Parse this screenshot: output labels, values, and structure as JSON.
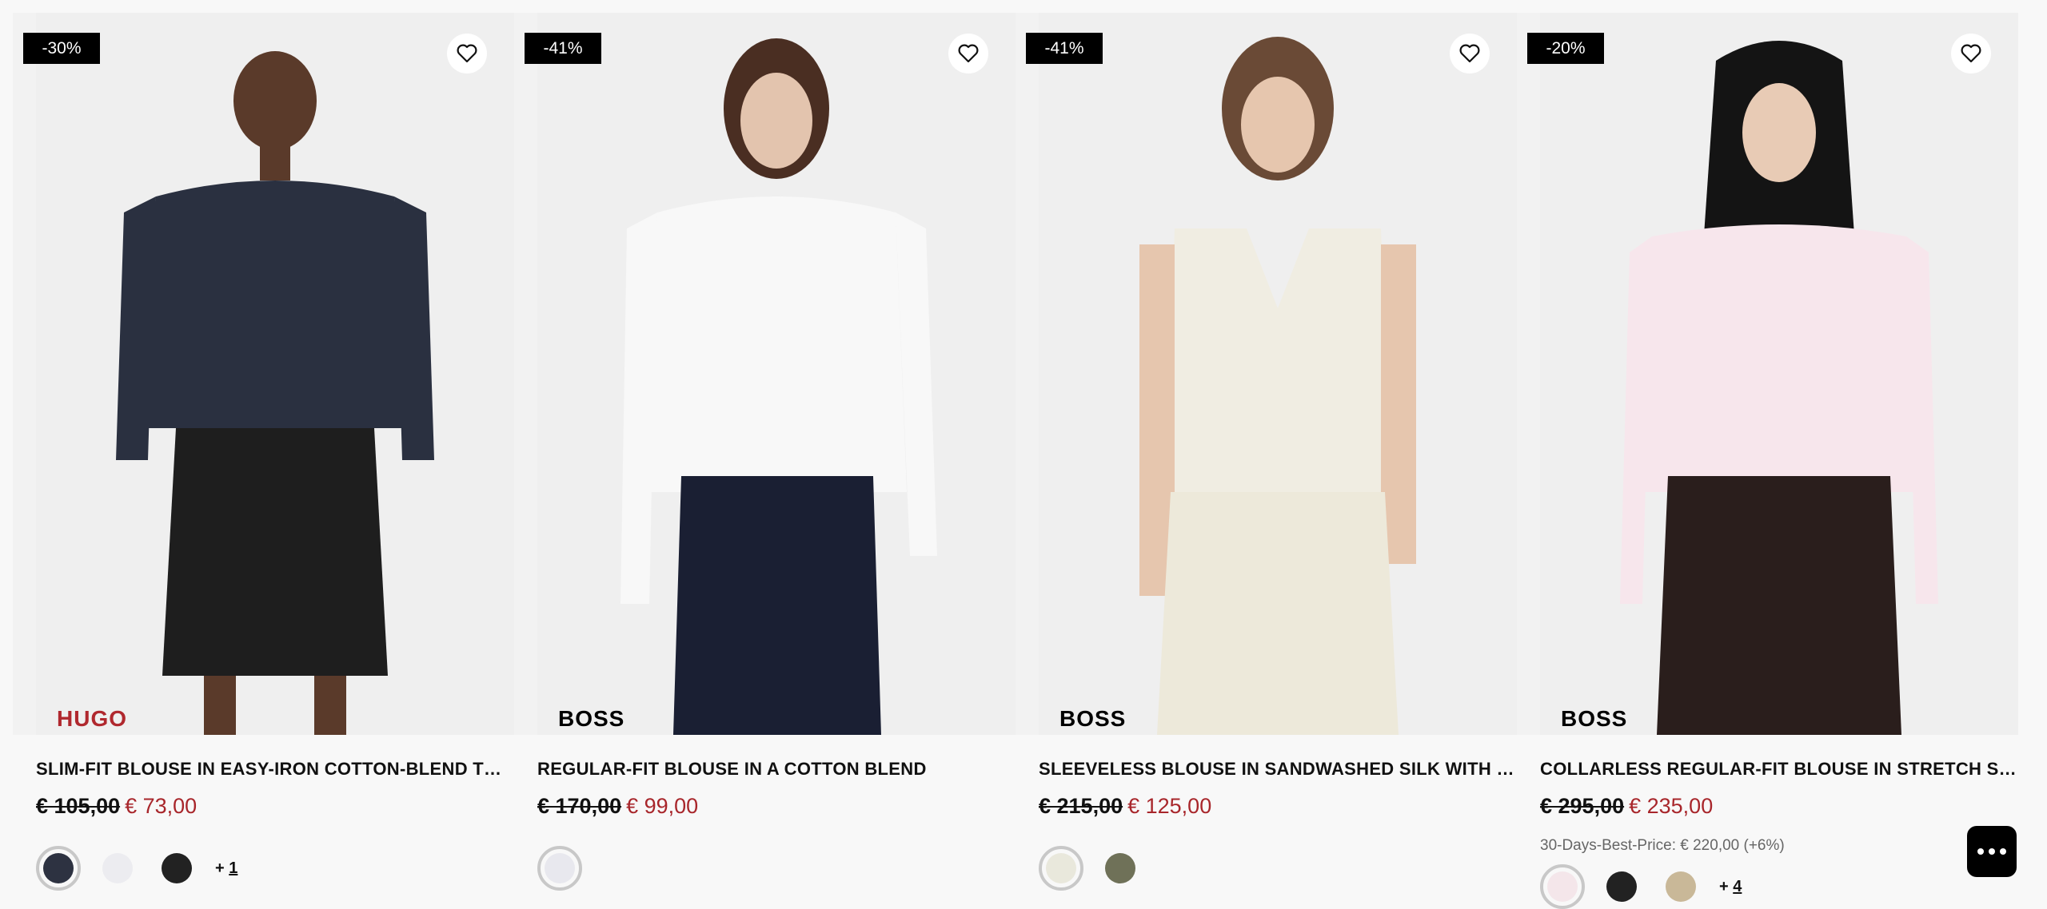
{
  "products": [
    {
      "discount": "-30%",
      "brand": "HUGO",
      "title": "SLIM-FIT BLOUSE IN EASY-IRON COTTON-BLEND TWILL",
      "old_price": "€ 105,00",
      "new_price": "€ 73,00",
      "best_price": "",
      "swatches": [
        "#2d3241",
        "#ececf0",
        "#222222"
      ],
      "more_label": "+ ",
      "more_count": "1",
      "colors": {
        "top": "#2a3040",
        "bottom": "#1e1e1e"
      }
    },
    {
      "discount": "-41%",
      "brand": "BOSS",
      "title": "REGULAR-FIT BLOUSE IN A COTTON BLEND",
      "old_price": "€ 170,00",
      "new_price": "€ 99,00",
      "best_price": "",
      "swatches": [
        "#e8e8ee"
      ],
      "more_label": "",
      "more_count": "",
      "colors": {
        "top": "#f6f6f6",
        "bottom": "#1a1f33"
      }
    },
    {
      "discount": "-41%",
      "brand": "BOSS",
      "title": "SLEEVELESS BLOUSE IN SANDWASHED SILK WITH V NECK",
      "old_price": "€ 215,00",
      "new_price": "€ 125,00",
      "best_price": "",
      "swatches": [
        "#e9e8dc",
        "#6f7158"
      ],
      "more_label": "",
      "more_count": "",
      "colors": {
        "top": "#f0ede2",
        "bottom": "#ede9da"
      }
    },
    {
      "discount": "-20%",
      "brand": "BOSS",
      "title": "COLLARLESS REGULAR-FIT BLOUSE IN STRETCH SILK",
      "old_price": "€ 295,00",
      "new_price": "€ 235,00",
      "best_price": "30-Days-Best-Price: € 220,00 (+6%)",
      "swatches": [
        "#f4e6ea",
        "#222222",
        "#c9b898"
      ],
      "more_label": "+ ",
      "more_count": "4",
      "colors": {
        "top": "#f7e6ec",
        "bottom": "#2a1e1c"
      }
    }
  ],
  "icons": {
    "wishlist": "heart-icon",
    "chat": "chat-dots-icon"
  },
  "accent": {
    "sale_price": "#a8262b",
    "hugo_brand": "#b0282e"
  }
}
